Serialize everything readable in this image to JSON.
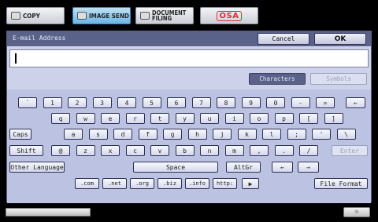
{
  "mode_tabs": {
    "copy": {
      "label": "COPY"
    },
    "image_send": {
      "label": "IMAGE SEND"
    },
    "document_filing": {
      "line1": "DOCUMENT",
      "line2": "FILING"
    },
    "osa": {
      "logo": "OSA"
    }
  },
  "dialog": {
    "title": "E-mail Address",
    "cancel_label": "Cancel",
    "ok_label": "OK",
    "entry_value": "",
    "characters_label": "Characters",
    "symbols_label": "Symbols"
  },
  "keyboard": {
    "row1": [
      "`",
      "1",
      "2",
      "3",
      "4",
      "5",
      "6",
      "7",
      "8",
      "9",
      "0",
      "-",
      "="
    ],
    "backspace": "←",
    "row2": [
      "q",
      "w",
      "e",
      "r",
      "t",
      "y",
      "u",
      "i",
      "o",
      "p",
      "[",
      "]"
    ],
    "caps": "Caps",
    "row3": [
      "a",
      "s",
      "d",
      "f",
      "g",
      "h",
      "j",
      "k",
      "l",
      ";",
      "'",
      "\\"
    ],
    "shift": "Shift",
    "row4": [
      "@",
      "z",
      "x",
      "c",
      "v",
      "b",
      "n",
      "m",
      ",",
      ".",
      "/"
    ],
    "enter": "Enter",
    "other_language": "Other Language",
    "space": "Space",
    "altgr": "AltGr",
    "arrow_left": "←",
    "arrow_right": "→",
    "domains": [
      ".com",
      ".net",
      ".org",
      ".biz",
      ".info",
      "http:"
    ],
    "play": "▶",
    "file_format": "File Format"
  },
  "colors": {
    "titlebar": "#5b628a",
    "dialog_bg": "#cdd1ea",
    "keyboard_bg": "#bcc2e2",
    "active_tab": "#6ab4e4",
    "osa_red": "#d63232"
  },
  "icons": {
    "copy_tab": "copier-icon",
    "image_send_tab": "scanner-icon",
    "document_filing_tab": "folder-icon",
    "brightness": "brightness-icon"
  },
  "brightness_glyph": "☼"
}
